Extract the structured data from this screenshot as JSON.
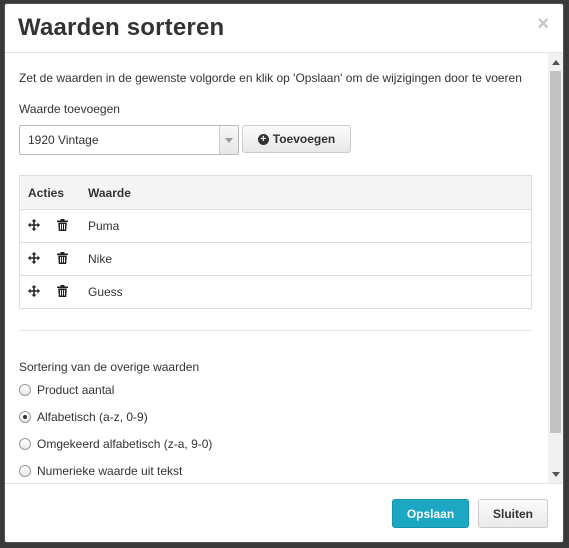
{
  "dialog": {
    "title": "Waarden sorteren",
    "close_symbol": "×"
  },
  "body": {
    "intro": "Zet de waarden in de gewenste volgorde en klik op 'Opslaan' om de wijzigingen door te voeren",
    "add_label": "Waarde toevoegen",
    "select_value": "1920 Vintage",
    "add_button": "Toevoegen"
  },
  "table": {
    "headers": [
      "Acties",
      "Waarde"
    ],
    "rows": [
      {
        "value": "Puma",
        "icons": [
          "move-icon",
          "trash-icon"
        ]
      },
      {
        "value": "Nike",
        "icons": [
          "move-icon",
          "trash-icon"
        ]
      },
      {
        "value": "Guess",
        "icons": [
          "move-icon",
          "trash-icon"
        ]
      }
    ]
  },
  "sorting": {
    "label": "Sortering van de overige waarden",
    "options": [
      {
        "label": "Product aantal",
        "checked": false
      },
      {
        "label": "Alfabetisch (a-z, 0-9)",
        "checked": true
      },
      {
        "label": "Omgekeerd alfabetisch (z-a, 9-0)",
        "checked": false
      },
      {
        "label": "Numerieke waarde uit tekst",
        "checked": false
      }
    ]
  },
  "footer": {
    "save": "Opslaan",
    "close": "Sluiten"
  },
  "colors": {
    "primary": "#1ca7c2",
    "overlay": "#3a3a3a"
  }
}
